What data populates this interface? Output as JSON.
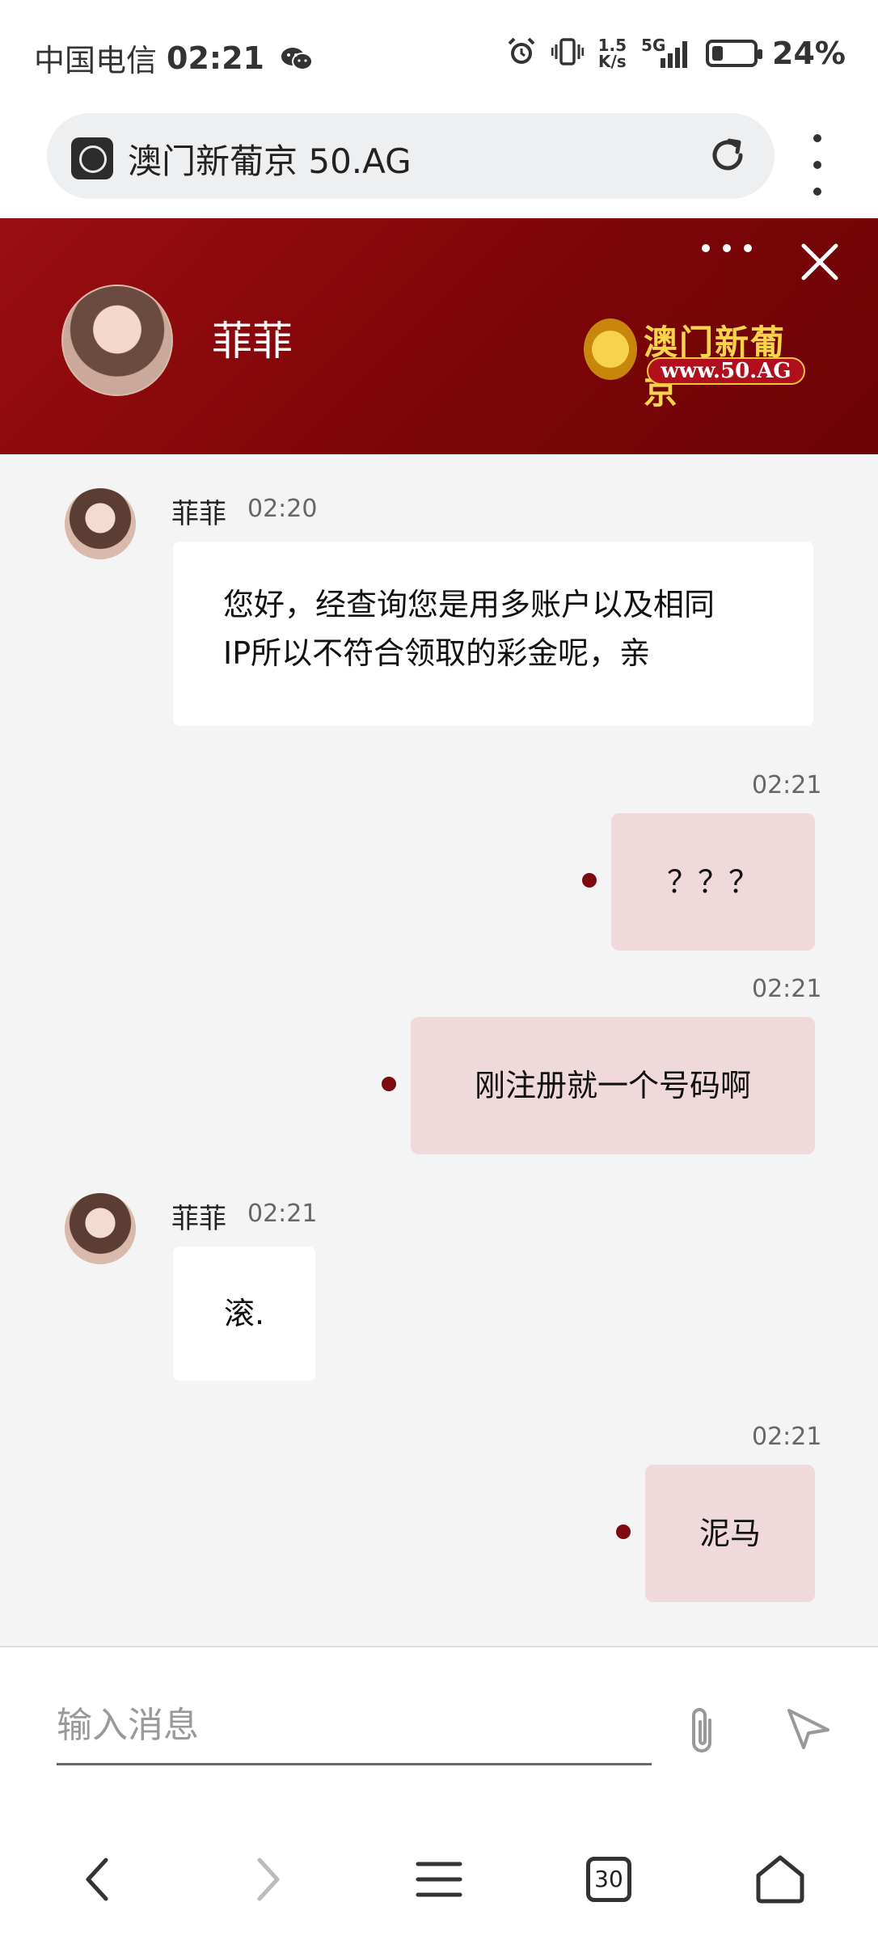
{
  "status_bar": {
    "carrier": "中国电信",
    "time": "02:21",
    "net_speed_top": "1.5",
    "net_speed_bottom": "K/s",
    "network": "5G",
    "battery_percent": "24%",
    "battery_level": 0.24
  },
  "browser": {
    "url_title": "澳门新葡京 50.AG",
    "tabs_count": "30"
  },
  "chat_header": {
    "agent_name": "菲菲",
    "logo_title": "澳门新葡京",
    "logo_url": "www.50.AG"
  },
  "messages": [
    {
      "direction": "in",
      "sender": "菲菲",
      "time": "02:20",
      "text_line1": "您好，经查询您是用多账户以及相同",
      "text_line2": "IP所以不符合领取的彩金呢，亲"
    },
    {
      "direction": "out",
      "time": "02:21",
      "text": "？？？"
    },
    {
      "direction": "out",
      "time": "02:21",
      "text": "刚注册就一个号码啊"
    },
    {
      "direction": "in",
      "sender": "菲菲",
      "time": "02:21",
      "text": "滚."
    },
    {
      "direction": "out",
      "time": "02:21",
      "text": "泥马"
    }
  ],
  "composer": {
    "placeholder": "输入消息"
  },
  "icons": {
    "close": "close-icon",
    "more": "more-icon",
    "attach": "paperclip-icon",
    "send": "send-icon"
  },
  "colors": {
    "header_red": "#7d0508",
    "outgoing_bubble": "#f0d9da",
    "chat_background": "#f4f4f4"
  }
}
